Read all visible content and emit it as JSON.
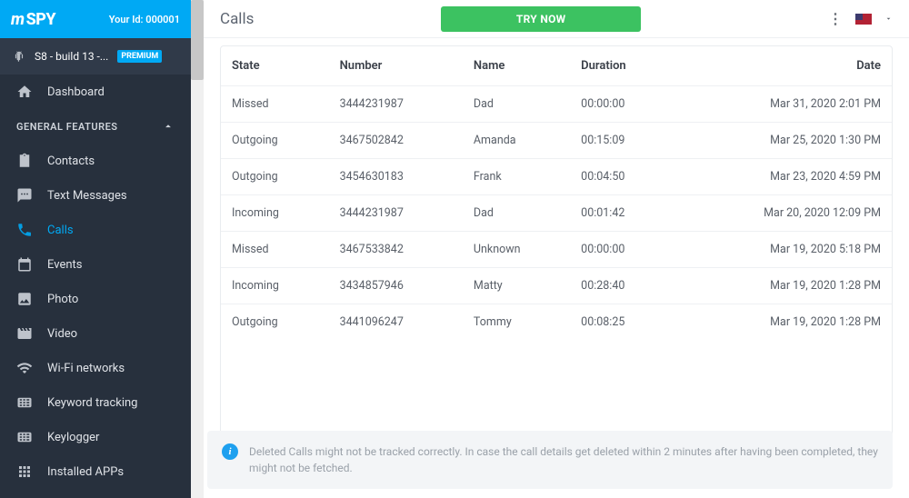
{
  "header": {
    "logo_prefix": "m",
    "logo_text": "SPY",
    "your_id_label": "Your Id:",
    "your_id_value": "000001"
  },
  "device": {
    "name": "S8 - build 13 -...",
    "badge": "PREMIUM"
  },
  "nav": {
    "dashboard": "Dashboard",
    "general_features": "GENERAL FEATURES",
    "items": [
      {
        "label": "Contacts"
      },
      {
        "label": "Text Messages"
      },
      {
        "label": "Calls"
      },
      {
        "label": "Events"
      },
      {
        "label": "Photo"
      },
      {
        "label": "Video"
      },
      {
        "label": "Wi-Fi networks"
      },
      {
        "label": "Keyword tracking"
      },
      {
        "label": "Keylogger"
      },
      {
        "label": "Installed APPs"
      }
    ]
  },
  "topbar": {
    "title": "Calls",
    "try_now": "TRY NOW"
  },
  "table": {
    "headers": {
      "state": "State",
      "number": "Number",
      "name": "Name",
      "duration": "Duration",
      "date": "Date"
    },
    "rows": [
      {
        "state": "Missed",
        "number": "3444231987",
        "name": "Dad",
        "duration": "00:00:00",
        "date": "Mar 31, 2020 2:01 PM"
      },
      {
        "state": "Outgoing",
        "number": "3467502842",
        "name": "Amanda",
        "duration": "00:15:09",
        "date": "Mar 25, 2020 1:30 PM"
      },
      {
        "state": "Outgoing",
        "number": "3454630183",
        "name": "Frank",
        "duration": "00:04:50",
        "date": "Mar 23, 2020 4:59 PM"
      },
      {
        "state": "Incoming",
        "number": "3444231987",
        "name": "Dad",
        "duration": "00:01:42",
        "date": "Mar 20, 2020 12:09 PM"
      },
      {
        "state": "Missed",
        "number": "3467533842",
        "name": "Unknown",
        "duration": "00:00:00",
        "date": "Mar 19, 2020 5:18 PM"
      },
      {
        "state": "Incoming",
        "number": "3434857946",
        "name": "Matty",
        "duration": "00:28:40",
        "date": "Mar 19, 2020 1:28 PM"
      },
      {
        "state": "Outgoing",
        "number": "3441096247",
        "name": "Tommy",
        "duration": "00:08:25",
        "date": "Mar 19, 2020 1:28 PM"
      }
    ]
  },
  "notice": "Deleted Calls might not be tracked correctly. In case the call details get deleted within 2 minutes after having been completed, they might not be fetched."
}
